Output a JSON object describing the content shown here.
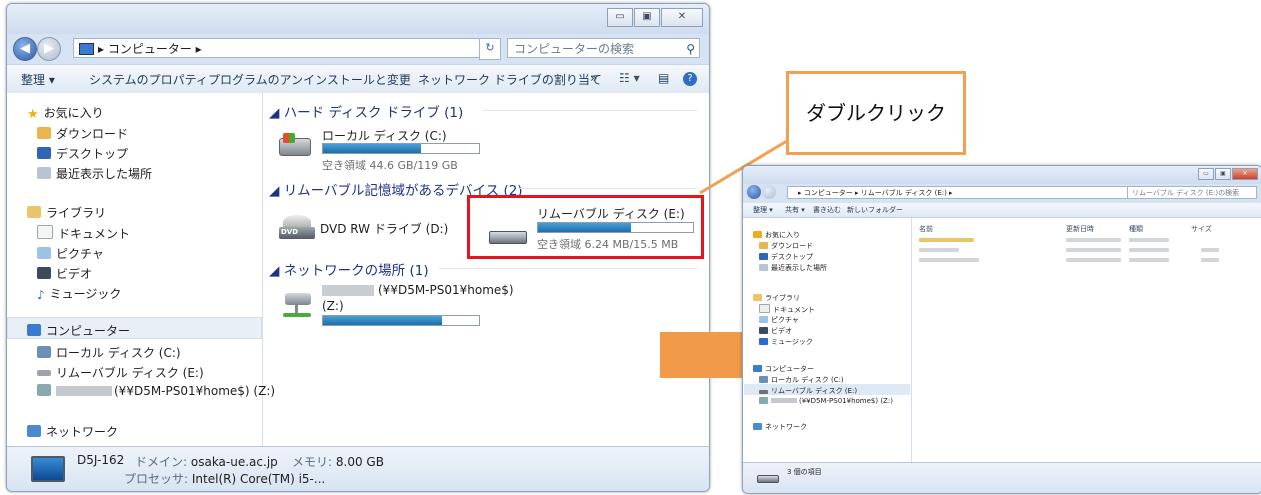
{
  "main_window": {
    "title_blur": "",
    "window_buttons": [
      "▭",
      "▣",
      "✕"
    ],
    "address": "▸ コンピューター ▸",
    "search_placeholder": "コンピューターの検索",
    "toolbar": [
      "整理 ▾",
      "システムのプロパティ",
      "プログラムのアンインストールと変更",
      "ネットワーク ドライブの割り当て",
      "»"
    ],
    "nav": {
      "favorites": "お気に入り",
      "downloads": "ダウンロード",
      "desktop": "デスクトップ",
      "recent": "最近表示した場所",
      "libraries": "ライブラリ",
      "documents": "ドキュメント",
      "pictures": "ピクチャ",
      "videos": "ビデオ",
      "music": "ミュージック",
      "computer": "コンピューター",
      "local_disk": "ローカル ディスク (C:)",
      "removable": "リムーバブル ディスク (E:)",
      "network_drive": "(¥¥D5M-PS01¥home$) (Z:)",
      "network": "ネットワーク"
    },
    "groups": {
      "hdd": "ハード ディスク ドライブ (1)",
      "removable": "リムーバブル記憶域があるデバイス (2)",
      "network": "ネットワークの場所 (1)"
    },
    "drives": {
      "c_name": "ローカル ディスク (C:)",
      "c_free": "空き領域 44.6 GB/119 GB",
      "c_fill": 0.63,
      "dvd_name": "DVD RW ドライブ (D:)",
      "e_name": "リムーバブル ディスク (E:)",
      "e_free": "空き領域 6.24 MB/15.5 MB",
      "e_fill": 0.6,
      "z_name": "(¥¥D5M-PS01¥home$)",
      "z_letter": "(Z:)",
      "z_fill": 0.76
    },
    "status": {
      "pc_name": "D5J-162",
      "domain_label": "ドメイン:",
      "domain": "osaka-ue.ac.jp",
      "memory_label": "メモリ:",
      "memory": "8.00 GB",
      "processor_label": "プロセッサ:",
      "processor": "Intel(R) Core(TM) i5-..."
    }
  },
  "callout": "ダブルクリック",
  "second_window": {
    "address": "▸ コンピューター ▸ リムーバブル ディスク (E:) ▸",
    "search_placeholder": "リムーバブル ディスク (E:)の検索",
    "toolbar": [
      "整理 ▾",
      "共有 ▾",
      "書き込む",
      "新しいフォルダー"
    ],
    "columns": [
      "名前",
      "更新日時",
      "種類",
      "サイズ"
    ],
    "nav": {
      "favorites": "お気に入り",
      "downloads": "ダウンロード",
      "desktop": "デスクトップ",
      "recent": "最近表示した場所",
      "libraries": "ライブラリ",
      "documents": "ドキュメント",
      "pictures": "ピクチャ",
      "videos": "ビデオ",
      "music": "ミュージック",
      "computer": "コンピューター",
      "local_disk": "ローカル ディスク (C:)",
      "removable": "リムーバブル ディスク (E:)",
      "network_drive": "(¥¥D5M-PS01¥home$) (Z:)",
      "network": "ネットワーク"
    },
    "status": "3 個の項目"
  },
  "colors": {
    "highlight": "#e8141c",
    "callout_border": "#f0a050",
    "arrow": "#f19a4a",
    "disk_bar": "#1a6fa8"
  }
}
